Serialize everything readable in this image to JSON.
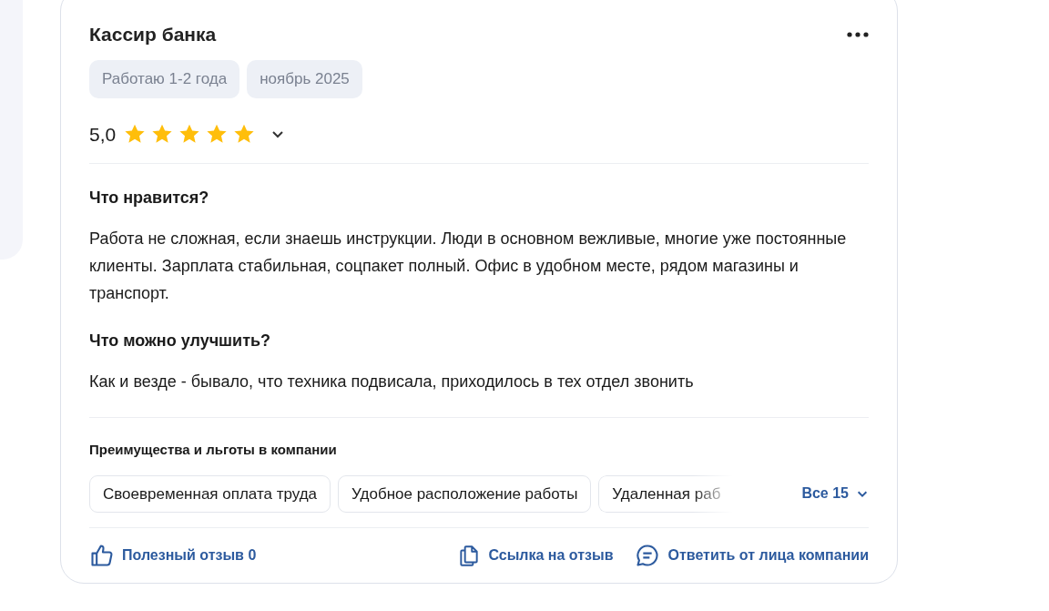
{
  "review": {
    "title": "Кассир банка",
    "tags": [
      "Работаю 1-2 года",
      "ноябрь 2025"
    ],
    "rating": {
      "value": "5,0",
      "stars": 5,
      "expanded": false
    },
    "sections": [
      {
        "heading": "Что нравится?",
        "text": "Работа не сложная, если знаешь инструкции. Люди в основном вежливые, многие уже постоянные клиенты. Зарплата стабильная, соцпакет полный. Офис в удобном месте, рядом магазины и транспорт."
      },
      {
        "heading": "Что можно улучшить?",
        "text": "Как и везде - бывало, что техника подвисала, приходилось в тех отдел звонить"
      }
    ],
    "benefits": {
      "heading": "Преимущества и льготы в компании",
      "items": [
        "Своевременная оплата труда",
        "Удобное расположение работы",
        "Удаленная раб"
      ],
      "more": "Все 15"
    },
    "actions": [
      {
        "kind": "like",
        "label": "Полезный отзыв 0"
      },
      {
        "kind": "link",
        "label": "Ссылка на отзыв"
      },
      {
        "kind": "reply",
        "label": "Ответить от лица компании"
      }
    ]
  }
}
